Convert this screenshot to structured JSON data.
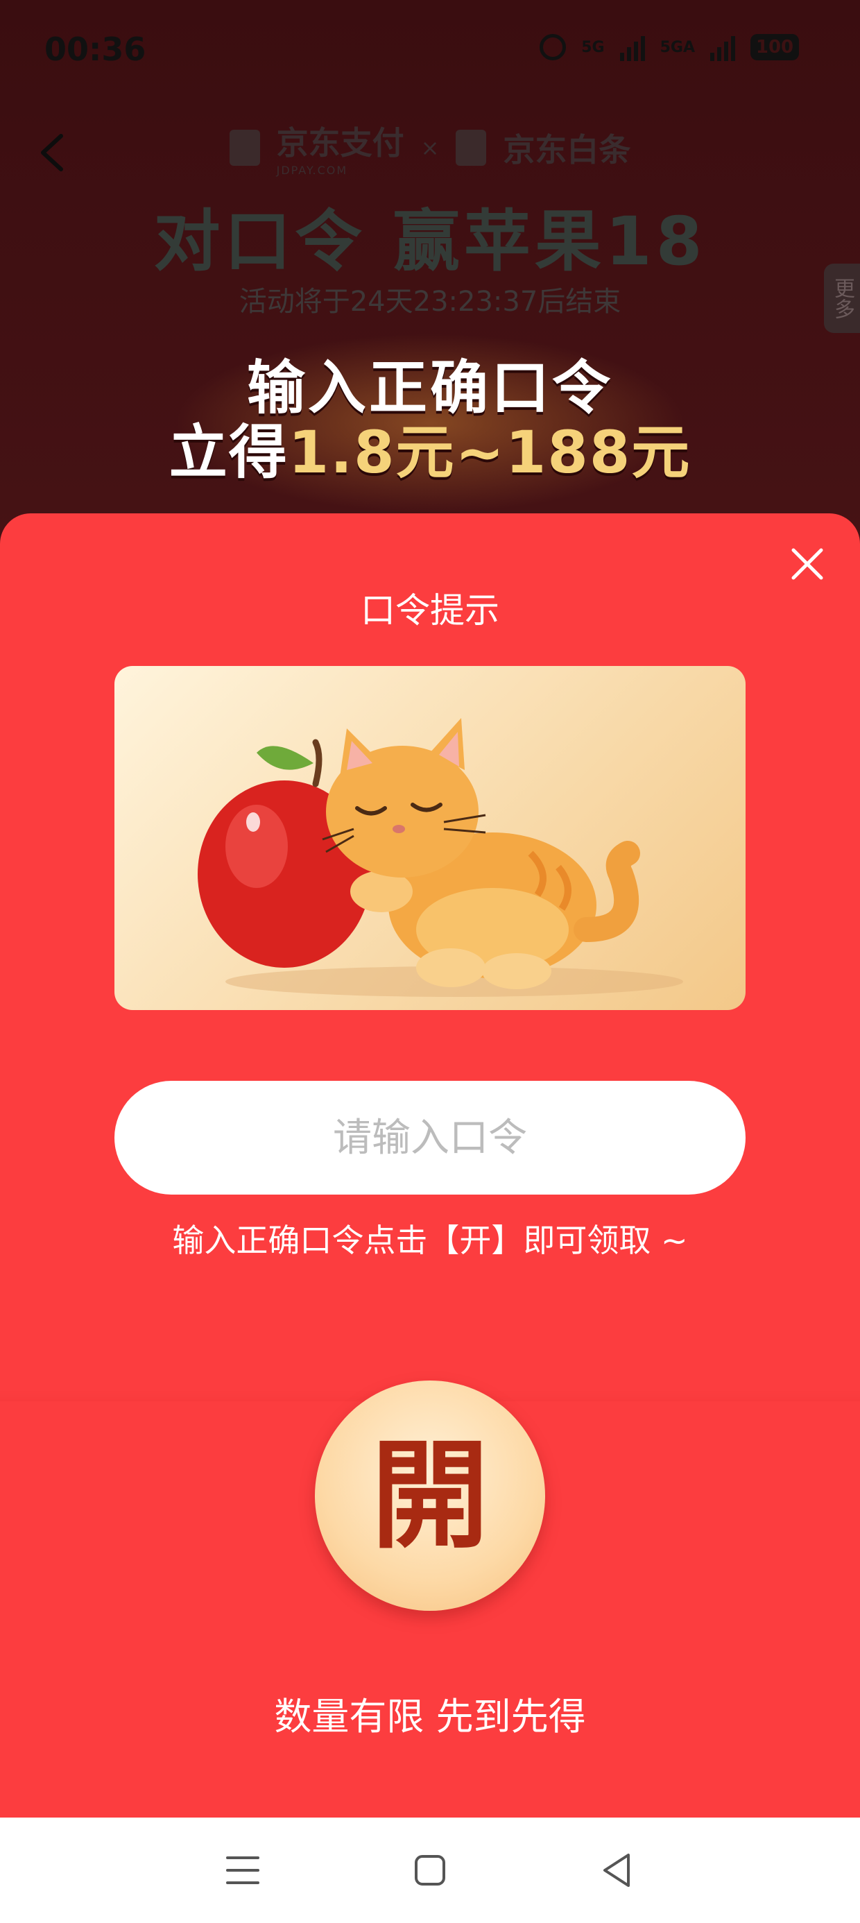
{
  "status": {
    "time": "00:36",
    "net1": "5G",
    "net2": "5GA",
    "battery": "100"
  },
  "background": {
    "brand_left": "京东支付",
    "brand_left_sub": "JDPAY.COM",
    "brand_sep": "×",
    "brand_right": "京东白条",
    "title": "对口令 赢苹果18",
    "countdown": "活动将于24天23:23:37后结束",
    "side_more": "更多",
    "promo_line1": "输入正确口令",
    "promo_line2_prefix": "立得",
    "promo_line2_amount": "1.8元~188元"
  },
  "popup": {
    "title": "口令提示",
    "input_placeholder": "请输入口令",
    "input_value": "",
    "tip": "输入正确口令点击【开】即可领取 ~",
    "open_label": "開",
    "footer": "数量有限 先到先得"
  },
  "colors": {
    "sheet": "#fc3d3f",
    "open_button": "#fdd9a6",
    "open_text": "#a82a12"
  },
  "icons": {
    "back": "chevron-left-icon",
    "close": "close-icon",
    "nav_menu": "menu-icon",
    "nav_home": "home-square-icon",
    "nav_back": "back-triangle-icon"
  }
}
